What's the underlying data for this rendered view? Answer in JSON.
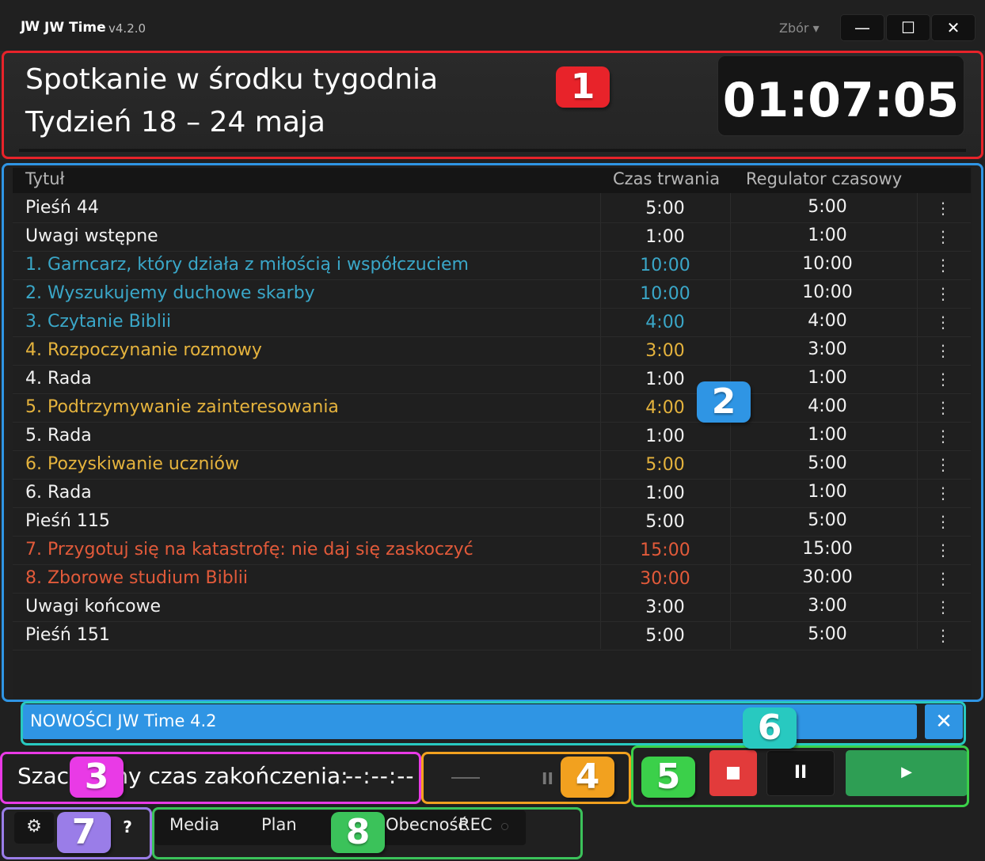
{
  "window": {
    "logo": "JW",
    "app_name": "JW Time",
    "version": "v4.2.0",
    "congregation": "Zbór ▾",
    "minimize": "—",
    "maximize": "☐",
    "close": "✕"
  },
  "header": {
    "title": "Spotkanie w środku tygodnia",
    "week": "Tydzień 18 – 24 maja",
    "clock": "01:07:05"
  },
  "table": {
    "columns": [
      "Tytuł",
      "Czas trwania",
      "Regulator czasowy"
    ],
    "rows": [
      {
        "title": "Pieśń 44",
        "duration": "5:00",
        "regulator": "5:00",
        "color": "#f2f2f2"
      },
      {
        "title": "Uwagi wstępne",
        "duration": "1:00",
        "regulator": "1:00",
        "color": "#f2f2f2"
      },
      {
        "title": "1. Garncarz, który działa z miłością i współczuciem",
        "duration": "10:00",
        "regulator": "10:00",
        "color": "#3aa7c8"
      },
      {
        "title": "2. Wyszukujemy duchowe skarby",
        "duration": "10:00",
        "regulator": "10:00",
        "color": "#3aa7c8"
      },
      {
        "title": "3. Czytanie Biblii",
        "duration": "4:00",
        "regulator": "4:00",
        "color": "#3aa7c8"
      },
      {
        "title": "4. Rozpoczynanie rozmowy",
        "duration": "3:00",
        "regulator": "3:00",
        "color": "#e5b33d"
      },
      {
        "title": "4. Rada",
        "duration": "1:00",
        "regulator": "1:00",
        "color": "#f2f2f2"
      },
      {
        "title": "5. Podtrzymywanie zainteresowania",
        "duration": "4:00",
        "regulator": "4:00",
        "color": "#e5b33d"
      },
      {
        "title": "5. Rada",
        "duration": "1:00",
        "regulator": "1:00",
        "color": "#f2f2f2"
      },
      {
        "title": "6. Pozyskiwanie uczniów",
        "duration": "5:00",
        "regulator": "5:00",
        "color": "#e5b33d"
      },
      {
        "title": "6. Rada",
        "duration": "1:00",
        "regulator": "1:00",
        "color": "#f2f2f2"
      },
      {
        "title": "Pieśń 115",
        "duration": "5:00",
        "regulator": "5:00",
        "color": "#f2f2f2"
      },
      {
        "title": "7. Przygotuj się na katastrofę: nie daj się zaskoczyć",
        "duration": "15:00",
        "regulator": "15:00",
        "color": "#e25a3a"
      },
      {
        "title": "8. Zborowe studium Biblii",
        "duration": "30:00",
        "regulator": "30:00",
        "color": "#e25a3a"
      },
      {
        "title": "Uwagi końcowe",
        "duration": "3:00",
        "regulator": "3:00",
        "color": "#f2f2f2"
      },
      {
        "title": "Pieśń 151",
        "duration": "5:00",
        "regulator": "5:00",
        "color": "#f2f2f2"
      }
    ],
    "row_menu": "⋮"
  },
  "news": {
    "text": "NOWOŚCI JW Time 4.2",
    "close": "✕"
  },
  "footer": {
    "end_label": "Szacowany czas zakończenia:",
    "end_value": "--:--:--",
    "pace_pause": "II",
    "pause": "II",
    "play": "▶",
    "settings": "⚙",
    "help": "?",
    "nav": {
      "media": "Media",
      "plan": "Plan",
      "attendance": "Obecność",
      "rec": "REC"
    }
  },
  "annotations": [
    {
      "label": "1",
      "color": "#e8232a"
    },
    {
      "label": "2",
      "color": "#2f95e4"
    },
    {
      "label": "3",
      "color": "#e93ae6"
    },
    {
      "label": "4",
      "color": "#f2a11f"
    },
    {
      "label": "5",
      "color": "#3bd04a"
    },
    {
      "label": "6",
      "color": "#28c9c0"
    },
    {
      "label": "7",
      "color": "#9a7de8"
    },
    {
      "label": "8",
      "color": "#3bc25a"
    }
  ]
}
